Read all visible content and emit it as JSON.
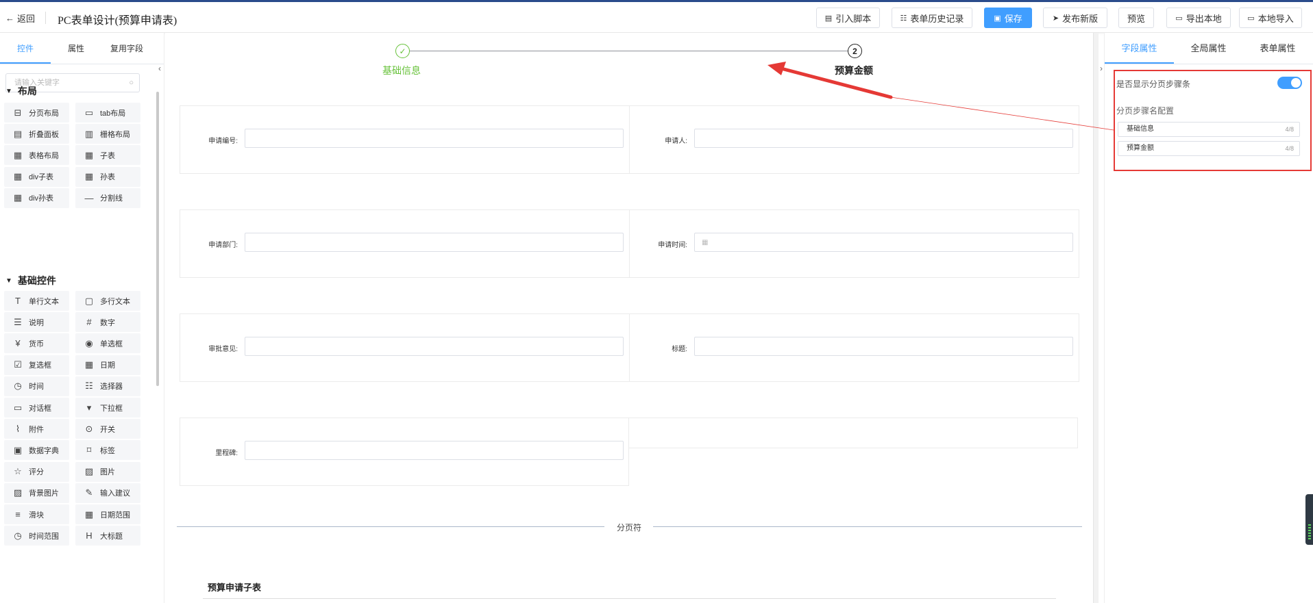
{
  "header": {
    "back_label": "返回",
    "title": "PC表单设计(预算申请表)",
    "buttons": {
      "import_script": "引入脚本",
      "history": "表单历史记录",
      "save": "保存",
      "publish": "发布新版",
      "preview": "预览",
      "export_local": "导出本地",
      "import_local": "本地导入"
    }
  },
  "left_panel": {
    "tabs": [
      "控件",
      "属性",
      "复用字段"
    ],
    "search_placeholder": "请输入关键字",
    "layout_section": "布局",
    "layout_items": [
      {
        "label": "分页布局",
        "icon": "paging-icon"
      },
      {
        "label": "tab布局",
        "icon": "tab-icon"
      },
      {
        "label": "折叠面板",
        "icon": "collapse-panel-icon"
      },
      {
        "label": "栅格布局",
        "icon": "grid-icon"
      },
      {
        "label": "表格布局",
        "icon": "table-icon"
      },
      {
        "label": "子表",
        "icon": "subtable-icon"
      },
      {
        "label": "div子表",
        "icon": "div-subtable-icon"
      },
      {
        "label": "孙表",
        "icon": "grandchild-table-icon"
      },
      {
        "label": "div孙表",
        "icon": "div-grandchild-table-icon"
      },
      {
        "label": "分割线",
        "icon": "divider-icon"
      }
    ],
    "basic_section": "基础控件",
    "basic_items": [
      {
        "label": "单行文本",
        "icon": "text-icon"
      },
      {
        "label": "多行文本",
        "icon": "textarea-icon"
      },
      {
        "label": "说明",
        "icon": "description-icon"
      },
      {
        "label": "数字",
        "icon": "number-icon"
      },
      {
        "label": "货币",
        "icon": "currency-icon"
      },
      {
        "label": "单选框",
        "icon": "radio-icon"
      },
      {
        "label": "复选框",
        "icon": "checkbox-icon"
      },
      {
        "label": "日期",
        "icon": "calendar-icon"
      },
      {
        "label": "时间",
        "icon": "clock-icon"
      },
      {
        "label": "选择器",
        "icon": "selector-icon"
      },
      {
        "label": "对话框",
        "icon": "dialog-icon"
      },
      {
        "label": "下拉框",
        "icon": "dropdown-icon"
      },
      {
        "label": "附件",
        "icon": "paperclip-icon"
      },
      {
        "label": "开关",
        "icon": "switch-icon"
      },
      {
        "label": "数据字典",
        "icon": "dictionary-icon"
      },
      {
        "label": "标签",
        "icon": "tag-icon"
      },
      {
        "label": "评分",
        "icon": "star-icon"
      },
      {
        "label": "图片",
        "icon": "image-icon"
      },
      {
        "label": "背景图片",
        "icon": "background-image-icon"
      },
      {
        "label": "输入建议",
        "icon": "suggestion-icon"
      },
      {
        "label": "滑块",
        "icon": "slider-icon"
      },
      {
        "label": "日期范围",
        "icon": "date-range-icon"
      },
      {
        "label": "时间范围",
        "icon": "time-range-icon"
      },
      {
        "label": "大标题",
        "icon": "heading-icon"
      }
    ]
  },
  "canvas": {
    "steps": [
      {
        "label": "基础信息",
        "marker": "✓",
        "status": "done"
      },
      {
        "label": "预算金额",
        "marker": "2",
        "status": "current"
      }
    ],
    "fields": {
      "apply_no": "申请编号:",
      "applicant": "申请人:",
      "apply_dept": "申请部门:",
      "apply_time": "申请时间:",
      "approval_opinion": "审批意见:",
      "subject": "标题:",
      "milestone": "里程碑:"
    },
    "page_break_label": "分页符",
    "subtable_title": "预算申请子表"
  },
  "right_panel": {
    "tabs": [
      "字段属性",
      "全局属性",
      "表单属性"
    ],
    "show_steps_label": "是否显示分页步骤条",
    "show_steps_on": true,
    "step_name_config_label": "分页步骤名配置",
    "step_names": [
      {
        "value": "基础信息",
        "count": "4/8"
      },
      {
        "value": "预算金额",
        "count": "4/8"
      }
    ]
  },
  "colors": {
    "primary": "#409eff",
    "success": "#67c23a",
    "highlight_box": "#e53935"
  }
}
